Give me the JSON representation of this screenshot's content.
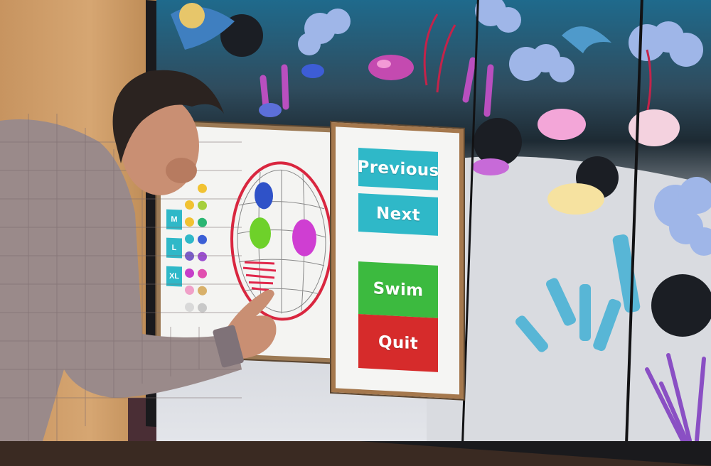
{
  "menu": {
    "previous_label": "Previous",
    "next_label": "Next",
    "swim_label": "Swim",
    "quit_label": "Quit"
  },
  "drawing_tools": {
    "sizes": [
      "M",
      "L",
      "XL"
    ],
    "palette": [
      "#f1c232",
      "#a6cf3c",
      "#2bb673",
      "#2fb8c8",
      "#7a5cc9",
      "#c63ec9",
      "#e14fb0",
      "#f0a0c8",
      "#d8b06a",
      "#c8c8c8"
    ]
  },
  "colors": {
    "button_teal": "#2fb8c8",
    "button_green": "#3cba3f",
    "button_red": "#d62b2b",
    "panel_frame": "#a5784d"
  }
}
